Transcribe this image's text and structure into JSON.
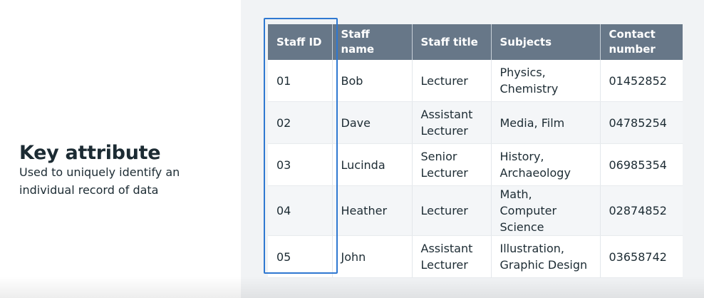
{
  "slide": {
    "title": "Key attribute",
    "description": "Used to uniquely identify an individual record of data"
  },
  "table": {
    "headers": [
      "Staff ID",
      "Staff name",
      "Staff title",
      "Subjects",
      "Contact number"
    ],
    "rows": [
      [
        "01",
        "Bob",
        "Lecturer",
        "Physics, Chemistry",
        "01452852"
      ],
      [
        "02",
        "Dave",
        "Assistant Lecturer",
        "Media, Film",
        "04785254"
      ],
      [
        "03",
        "Lucinda",
        "Senior Lecturer",
        "History, Archaeology",
        "06985354"
      ],
      [
        "04",
        "Heather",
        "Lecturer",
        "Math, Computer Science",
        "02874852"
      ],
      [
        "05",
        "John",
        "Assistant Lecturer",
        "Illustration, Graphic Design",
        "03658742"
      ]
    ]
  },
  "colors": {
    "header_background": "#677788",
    "highlight_border": "#2f78d1",
    "text": "#1c2b33",
    "right_panel_background": "#f1f3f5"
  }
}
